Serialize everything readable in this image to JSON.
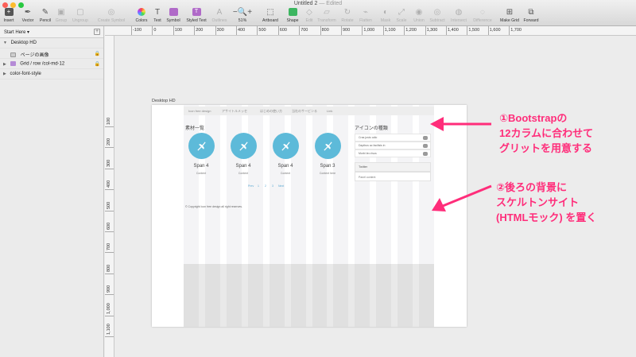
{
  "window": {
    "title": "Untitled 2",
    "status": "— Edited"
  },
  "toolbar": {
    "items": [
      {
        "label": "Insert",
        "icon": "plus-icon"
      },
      {
        "label": "Vector",
        "icon": "vector-icon"
      },
      {
        "label": "Pencil",
        "icon": "pencil-icon"
      },
      {
        "label": "Group",
        "icon": "group-icon"
      },
      {
        "label": "Ungroup",
        "icon": "ungroup-icon"
      },
      {
        "label": "Create Symbol",
        "icon": "symbol-icon"
      },
      {
        "label": "Colors",
        "icon": "color-wheel-icon"
      },
      {
        "label": "Text",
        "icon": "text-icon"
      },
      {
        "label": "Symbol",
        "icon": "symbol-icon"
      },
      {
        "label": "Styled Text",
        "icon": "styled-text-icon"
      },
      {
        "label": "Outlines",
        "icon": "outline-icon"
      },
      {
        "label": "51%",
        "icon": "zoom-icon"
      },
      {
        "label": "Artboard",
        "icon": "artboard-icon"
      },
      {
        "label": "Shape",
        "icon": "shape-icon"
      },
      {
        "label": "Edit",
        "icon": "edit-icon"
      },
      {
        "label": "Transform",
        "icon": "transform-icon"
      },
      {
        "label": "Rotate",
        "icon": "rotate-icon"
      },
      {
        "label": "Flatten",
        "icon": "flatten-icon"
      },
      {
        "label": "Mask",
        "icon": "mask-icon"
      },
      {
        "label": "Scale",
        "icon": "scale-icon"
      },
      {
        "label": "Union",
        "icon": "union-icon"
      },
      {
        "label": "Subtract",
        "icon": "subtract-icon"
      },
      {
        "label": "Intersect",
        "icon": "intersect-icon"
      },
      {
        "label": "Difference",
        "icon": "difference-icon"
      },
      {
        "label": "Make Grid",
        "icon": "grid-icon"
      },
      {
        "label": "Forward",
        "icon": "forward-icon"
      }
    ],
    "zoom_minus": "−",
    "zoom_plus": "+"
  },
  "sidebar": {
    "page": "Start Here",
    "page_caret": "▾",
    "add_label": "+",
    "layers": [
      {
        "name": "Desktop HD",
        "expanded": true
      },
      {
        "name": "ページの画像",
        "locked": true
      },
      {
        "name": "Grid / row /col-md-12",
        "locked": true
      },
      {
        "name": "color-font-style"
      }
    ],
    "lock_glyph": "🔒",
    "expanded_glyph": "▼",
    "collapsed_glyph": "▶"
  },
  "rulers": {
    "top": [
      "-100",
      "0",
      "100",
      "200",
      "300",
      "400",
      "500",
      "600",
      "700",
      "800",
      "900",
      "1,000",
      "1,100",
      "1,200",
      "1,300",
      "1,400",
      "1,500",
      "1,600",
      "1,700"
    ],
    "left": [
      "100",
      "200",
      "300",
      "400",
      "500",
      "600",
      "700",
      "800",
      "900",
      "1,000",
      "1,100"
    ]
  },
  "artboard": {
    "label": "Desktop HD",
    "nav": [
      "Icon free design",
      "アサイトルメッセ",
      "はじめの使い方",
      "当社のサービンる",
      "Link"
    ],
    "section_left": "素材一覧",
    "section_right": "アイコンの種類",
    "cards": [
      {
        "title": "Span 4",
        "body": "Content"
      },
      {
        "title": "Span 4",
        "body": "Content"
      },
      {
        "title": "Span 4",
        "body": "Content"
      },
      {
        "title": "Span 3",
        "body": "Content here"
      }
    ],
    "pager": [
      "Prev",
      "1",
      "2",
      "3",
      "Next"
    ],
    "copyright": "© Copyright Icon free design all right reserves.",
    "list": [
      "Cras justo odio",
      "Dapibus ac facilisis in",
      "Morbi leo risus"
    ],
    "panel_title": "Twitter",
    "panel_body": "Panel content"
  },
  "annotations": {
    "first": [
      "①Bootstrapの",
      "12カラムに合わせて",
      "グリットを用意する"
    ],
    "second": [
      "②後ろの背景に",
      "スケルトンサイト",
      "(HTMLモック) を置く"
    ]
  },
  "colors": {
    "accent": "#ff2d7a",
    "circle": "#5dbad9",
    "layer_folder": "#b58bd6"
  }
}
